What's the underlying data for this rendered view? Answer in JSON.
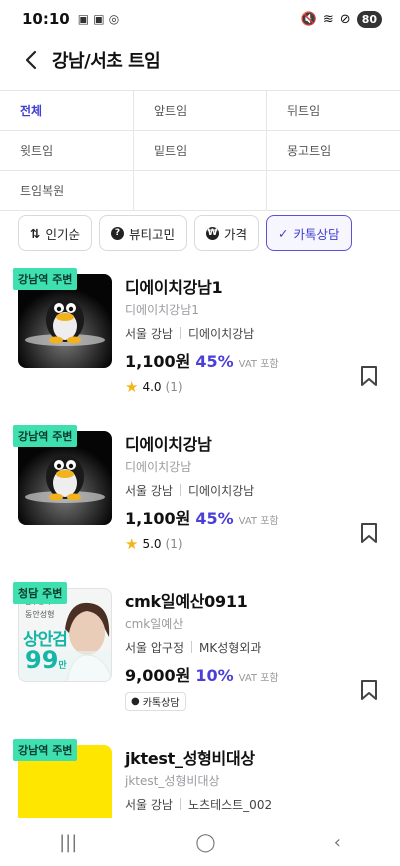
{
  "status": {
    "time": "10:10",
    "battery": "80"
  },
  "header": {
    "title": "강남/서초 트임"
  },
  "categories": [
    "전체",
    "앞트임",
    "뒤트임",
    "윗트임",
    "밑트임",
    "몽고트임",
    "트임복원",
    "",
    ""
  ],
  "chips": [
    {
      "label": "인기순",
      "icon": "sort-icon"
    },
    {
      "label": "뷰티고민",
      "icon": "question-icon"
    },
    {
      "label": "가격",
      "icon": "won-icon"
    },
    {
      "label": "카톡상담",
      "icon": "check-icon"
    }
  ],
  "items": [
    {
      "tag": "강남역 주변",
      "name": "디에이치강남1",
      "sub": "디에이치강남1",
      "city": "서울 강남",
      "clinic": "디에이치강남",
      "price": "1,100원",
      "discount": "45%",
      "vat": "VAT 포함",
      "rating": "4.0",
      "count": "(1)"
    },
    {
      "tag": "강남역 주변",
      "name": "디에이치강남",
      "sub": "디에이치강남",
      "city": "서울 강남",
      "clinic": "디에이치강남",
      "price": "1,100원",
      "discount": "45%",
      "vat": "VAT 포함",
      "rating": "5.0",
      "count": "(1)"
    },
    {
      "tag": "청담 주변",
      "name": "cmk일예산0911",
      "sub": "cmk일예산",
      "city": "서울 압구정",
      "clinic": "MK성형외과",
      "price": "9,000원",
      "discount": "10%",
      "vat": "VAT 포함",
      "kakao": "카톡상담",
      "promo_top": "압구정역",
      "promo_mid": "동안성형",
      "promo_big": "상안검",
      "promo_num": "99",
      "promo_unit": "만"
    },
    {
      "tag": "강남역 주변",
      "name": "jktest_성형비대상",
      "sub": "jktest_성형비대상",
      "city": "서울 강남",
      "clinic": "노츠테스트_002"
    }
  ]
}
